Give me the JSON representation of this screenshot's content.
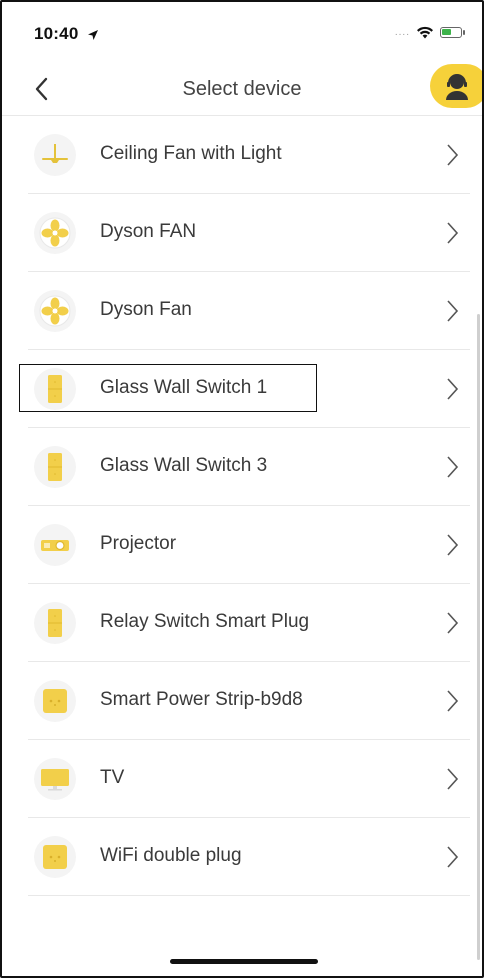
{
  "status": {
    "time": "10:40"
  },
  "nav": {
    "title": "Select device"
  },
  "devices": [
    {
      "label": "Ceiling Fan with Light",
      "icon": "ceiling-fan-icon"
    },
    {
      "label": "Dyson FAN",
      "icon": "fan-icon"
    },
    {
      "label": "Dyson Fan",
      "icon": "fan-icon"
    },
    {
      "label": "Glass Wall Switch 1",
      "icon": "wall-switch-icon"
    },
    {
      "label": "Glass Wall Switch 3",
      "icon": "wall-switch-icon"
    },
    {
      "label": "Projector",
      "icon": "projector-icon"
    },
    {
      "label": "Relay Switch Smart Plug",
      "icon": "wall-switch-icon"
    },
    {
      "label": "Smart Power Strip-b9d8",
      "icon": "power-strip-icon"
    },
    {
      "label": "TV",
      "icon": "tv-icon"
    },
    {
      "label": "WiFi double plug",
      "icon": "power-strip-icon"
    }
  ],
  "colors": {
    "accent": "#f6d13a",
    "icon_fill": "#f2cf4a",
    "battery": "#3db34a"
  }
}
